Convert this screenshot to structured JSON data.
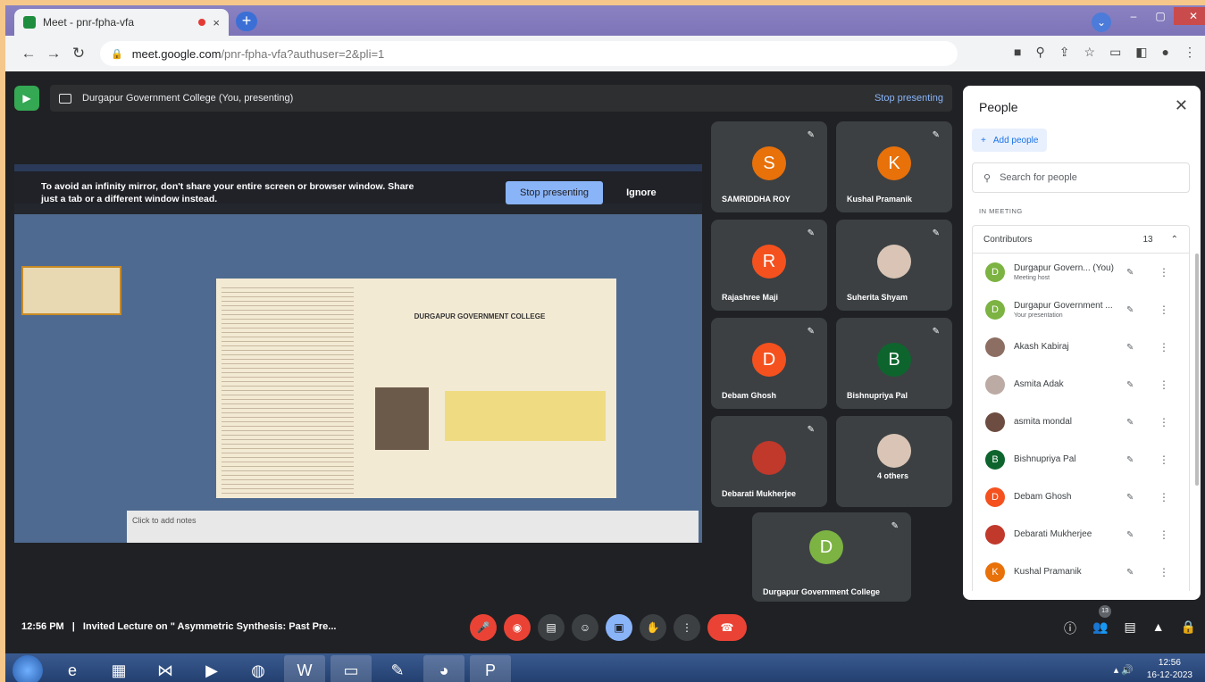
{
  "browser": {
    "tab_title": "Meet - pnr-fpha-vfa",
    "tab_close": "×",
    "new_tab": "+",
    "url_domain": "meet.google.com",
    "url_path": "/pnr-fpha-vfa?authuser=2&pli=1",
    "window_controls": [
      "–",
      "▢",
      "✕"
    ]
  },
  "meet": {
    "presenting_label": "Durgapur Government College (You, presenting)",
    "stop_presenting_link": "Stop presenting",
    "warning": {
      "message": "To avoid an infinity mirror, don't share your entire screen or browser window. Share just a tab or a different window instead.",
      "stop_button": "Stop presenting",
      "ignore_button": "Ignore"
    },
    "tiles": [
      {
        "name": "SAMRIDDHA ROY",
        "initial": "S",
        "color": "#e8710a"
      },
      {
        "name": "Kushal Pramanik",
        "initial": "K",
        "color": "#e8710a"
      },
      {
        "name": "Rajashree Maji",
        "initial": "R",
        "color": "#f4511e"
      },
      {
        "name": "Suherita Shyam",
        "initial": "",
        "color": "#d9c4b5"
      },
      {
        "name": "Debam Ghosh",
        "initial": "D",
        "color": "#f4511e"
      },
      {
        "name": "Bishnupriya Pal",
        "initial": "B",
        "color": "#0d652d"
      },
      {
        "name": "Debarati Mukherjee",
        "initial": "",
        "color": "#c0392b"
      },
      {
        "name": "4 others",
        "initial": "",
        "color": "#d9c4b5"
      },
      {
        "name": "Durgapur Government College",
        "initial": "D",
        "color": "#7cb342"
      }
    ],
    "slide_notes": "Click to add notes",
    "slide_title": "DURGAPUR GOVERNMENT COLLEGE"
  },
  "people": {
    "title": "People",
    "add_people": "Add people",
    "search_placeholder": "Search for people",
    "section": "IN MEETING",
    "contributors_label": "Contributors",
    "contributors_count": "13",
    "list": [
      {
        "name": "Durgapur Govern... (You)",
        "sub": "Meeting host",
        "initial": "D",
        "color": "#7cb342"
      },
      {
        "name": "Durgapur Government ...",
        "sub": "Your presentation",
        "initial": "D",
        "color": "#7cb342"
      },
      {
        "name": "Akash Kabiraj",
        "sub": "",
        "initial": "",
        "color": "#8d6e63"
      },
      {
        "name": "Asmita Adak",
        "sub": "",
        "initial": "",
        "color": "#bcaaa4"
      },
      {
        "name": "asmita mondal",
        "sub": "",
        "initial": "",
        "color": "#6d4c41"
      },
      {
        "name": "Bishnupriya Pal",
        "sub": "",
        "initial": "B",
        "color": "#0d652d"
      },
      {
        "name": "Debam Ghosh",
        "sub": "",
        "initial": "D",
        "color": "#f4511e"
      },
      {
        "name": "Debarati Mukherjee",
        "sub": "",
        "initial": "",
        "color": "#c0392b"
      },
      {
        "name": "Kushal Pramanik",
        "sub": "",
        "initial": "K",
        "color": "#e8710a"
      }
    ]
  },
  "bottom": {
    "time": "12:56 PM",
    "separator": "|",
    "meeting_title": "Invited Lecture on \" Asymmetric Synthesis: Past Pre...",
    "participant_badge": "13"
  },
  "taskbar": {
    "clock_time": "12:56",
    "clock_date": "16-12-2023"
  }
}
